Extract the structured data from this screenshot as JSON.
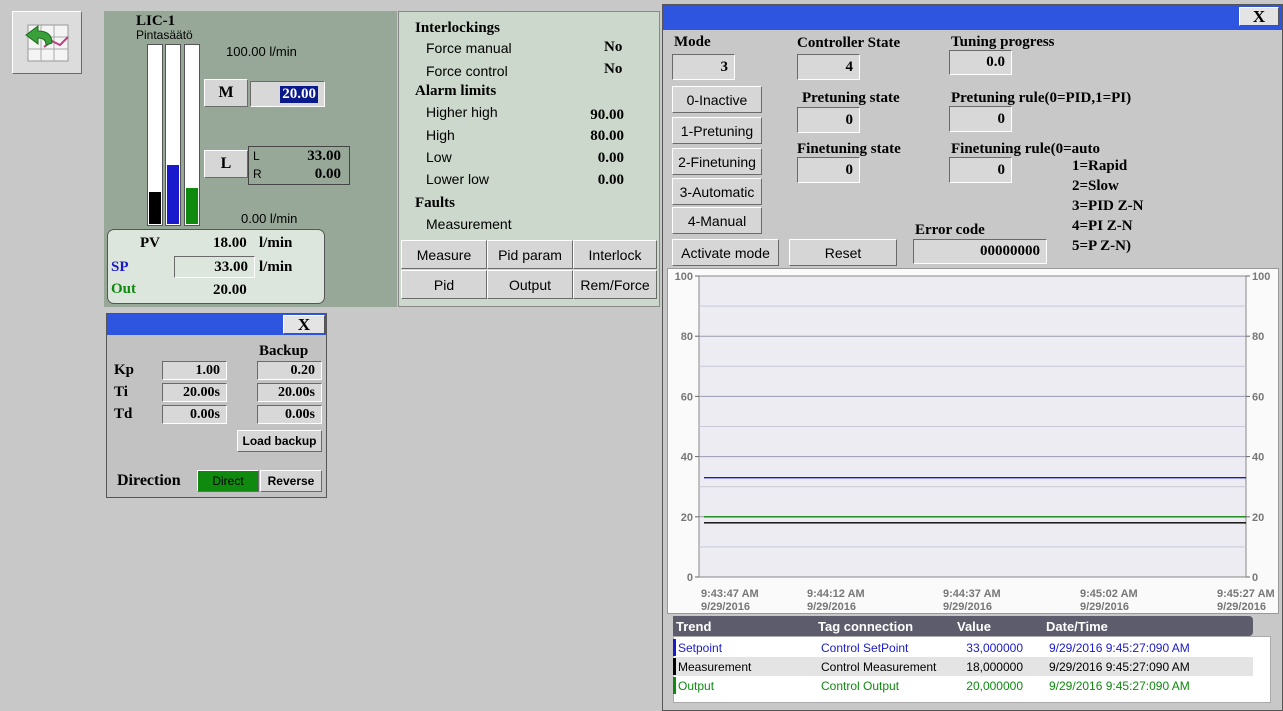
{
  "toolbar": {
    "back_icon": "back-arrow-icon"
  },
  "lic": {
    "tag": "LIC-1",
    "subtitle": "Pintasäätö",
    "scale_max": "100.00 l/min",
    "scale_min": "0.00 l/min",
    "bar_levels": {
      "measurement": 0.18,
      "setpoint": 0.33,
      "output": 0.2
    },
    "bar_colors": {
      "measurement": "#000000",
      "setpoint": "#1a1acc",
      "output": "#0f8a0f"
    },
    "m_label": "M",
    "m_value": "20.00",
    "l_label": "L",
    "l_row_label": "L",
    "l_row_value": "33.00",
    "r_row_label": "R",
    "r_row_value": "0.00",
    "pv_label": "PV",
    "pv_value": "18.00",
    "sp_label": "SP",
    "sp_value": "33.00",
    "out_label": "Out",
    "out_value": "20.00",
    "unit": "l/min"
  },
  "interlock_panel": {
    "interlockings_title": "Interlockings",
    "force_manual_label": "Force manual",
    "force_manual_value": "No",
    "force_control_label": "Force control",
    "force_control_value": "No",
    "alarm_limits_title": "Alarm limits",
    "higher_high_label": "Higher high",
    "higher_high_value": "90.00",
    "high_label": "High",
    "high_value": "80.00",
    "low_label": "Low",
    "low_value": "0.00",
    "lower_low_label": "Lower low",
    "lower_low_value": "0.00",
    "faults_title": "Faults",
    "measurement_label": "Measurement",
    "buttons": [
      "Measure",
      "Pid param",
      "Interlock",
      "Pid",
      "Output",
      "Rem/Force"
    ]
  },
  "pid_window": {
    "close_label": "X",
    "backup_label": "Backup",
    "kp_label": "Kp",
    "kp_value": "1.00",
    "kp_backup": "0.20",
    "ti_label": "Ti",
    "ti_value": "20.00s",
    "ti_backup": "20.00s",
    "td_label": "Td",
    "td_value": "0.00s",
    "td_backup": "0.00s",
    "load_backup_label": "Load backup",
    "direction_label": "Direction",
    "direct_label": "Direct",
    "reverse_label": "Reverse"
  },
  "tuning_window": {
    "close_label": "X",
    "mode_label": "Mode",
    "mode_value": "3",
    "controller_state_label": "Controller State",
    "controller_state_value": "4",
    "tuning_progress_label": "Tuning progress",
    "tuning_progress_value": "0.0",
    "mode_buttons": [
      "0-Inactive",
      "1-Pretuning",
      "2-Finetuning",
      "3-Automatic",
      "4-Manual"
    ],
    "pretuning_state_label": "Pretuning state",
    "pretuning_state_value": "0",
    "pretuning_rule_label": "Pretuning rule(0=PID,1=PI)",
    "pretuning_rule_value": "0",
    "finetuning_state_label": "Finetuning state",
    "finetuning_state_value": "0",
    "finetuning_rule_label": "Finetuning rule(0=auto",
    "finetuning_rule_value": "0",
    "rule_options": [
      "1=Rapid",
      "2=Slow",
      "3=PID Z-N",
      "4=PI Z-N",
      "5=P Z-N)"
    ],
    "error_code_label": "Error code",
    "error_code_value": "00000000",
    "activate_mode_label": "Activate mode",
    "reset_label": "Reset"
  },
  "chart_data": {
    "type": "line",
    "ylim": [
      0,
      100
    ],
    "y_ticks": [
      "0",
      "20",
      "40",
      "60",
      "80",
      "100"
    ],
    "x_ticks": [
      {
        "time": "9:43:47 AM",
        "date": "9/29/2016"
      },
      {
        "time": "9:44:12 AM",
        "date": "9/29/2016"
      },
      {
        "time": "9:44:37 AM",
        "date": "9/29/2016"
      },
      {
        "time": "9:45:02 AM",
        "date": "9/29/2016"
      },
      {
        "time": "9:45:27 AM",
        "date": "9/29/2016"
      }
    ],
    "series": [
      {
        "name": "Setpoint",
        "color": "#1a1acc",
        "values": [
          33,
          33
        ]
      },
      {
        "name": "Measurement",
        "color": "#000000",
        "values": [
          18,
          18
        ]
      },
      {
        "name": "Output",
        "color": "#0f8a0f",
        "values": [
          20,
          20
        ]
      }
    ],
    "grid": true
  },
  "trend_table": {
    "headers": [
      "Trend",
      "Tag connection",
      "Value",
      "Date/Time"
    ],
    "rows": [
      {
        "trend": "Setpoint",
        "tag": "Control SetPoint",
        "value": "33,000000",
        "datetime": "9/29/2016 9:45:27:090 AM",
        "color": "#1a1acc"
      },
      {
        "trend": "Measurement",
        "tag": "Control Measurement",
        "value": "18,000000",
        "datetime": "9/29/2016 9:45:27:090 AM",
        "color": "#000000"
      },
      {
        "trend": "Output",
        "tag": "Control Output",
        "value": "20,000000",
        "datetime": "9/29/2016 9:45:27:090 AM",
        "color": "#0f8a0f"
      }
    ]
  }
}
